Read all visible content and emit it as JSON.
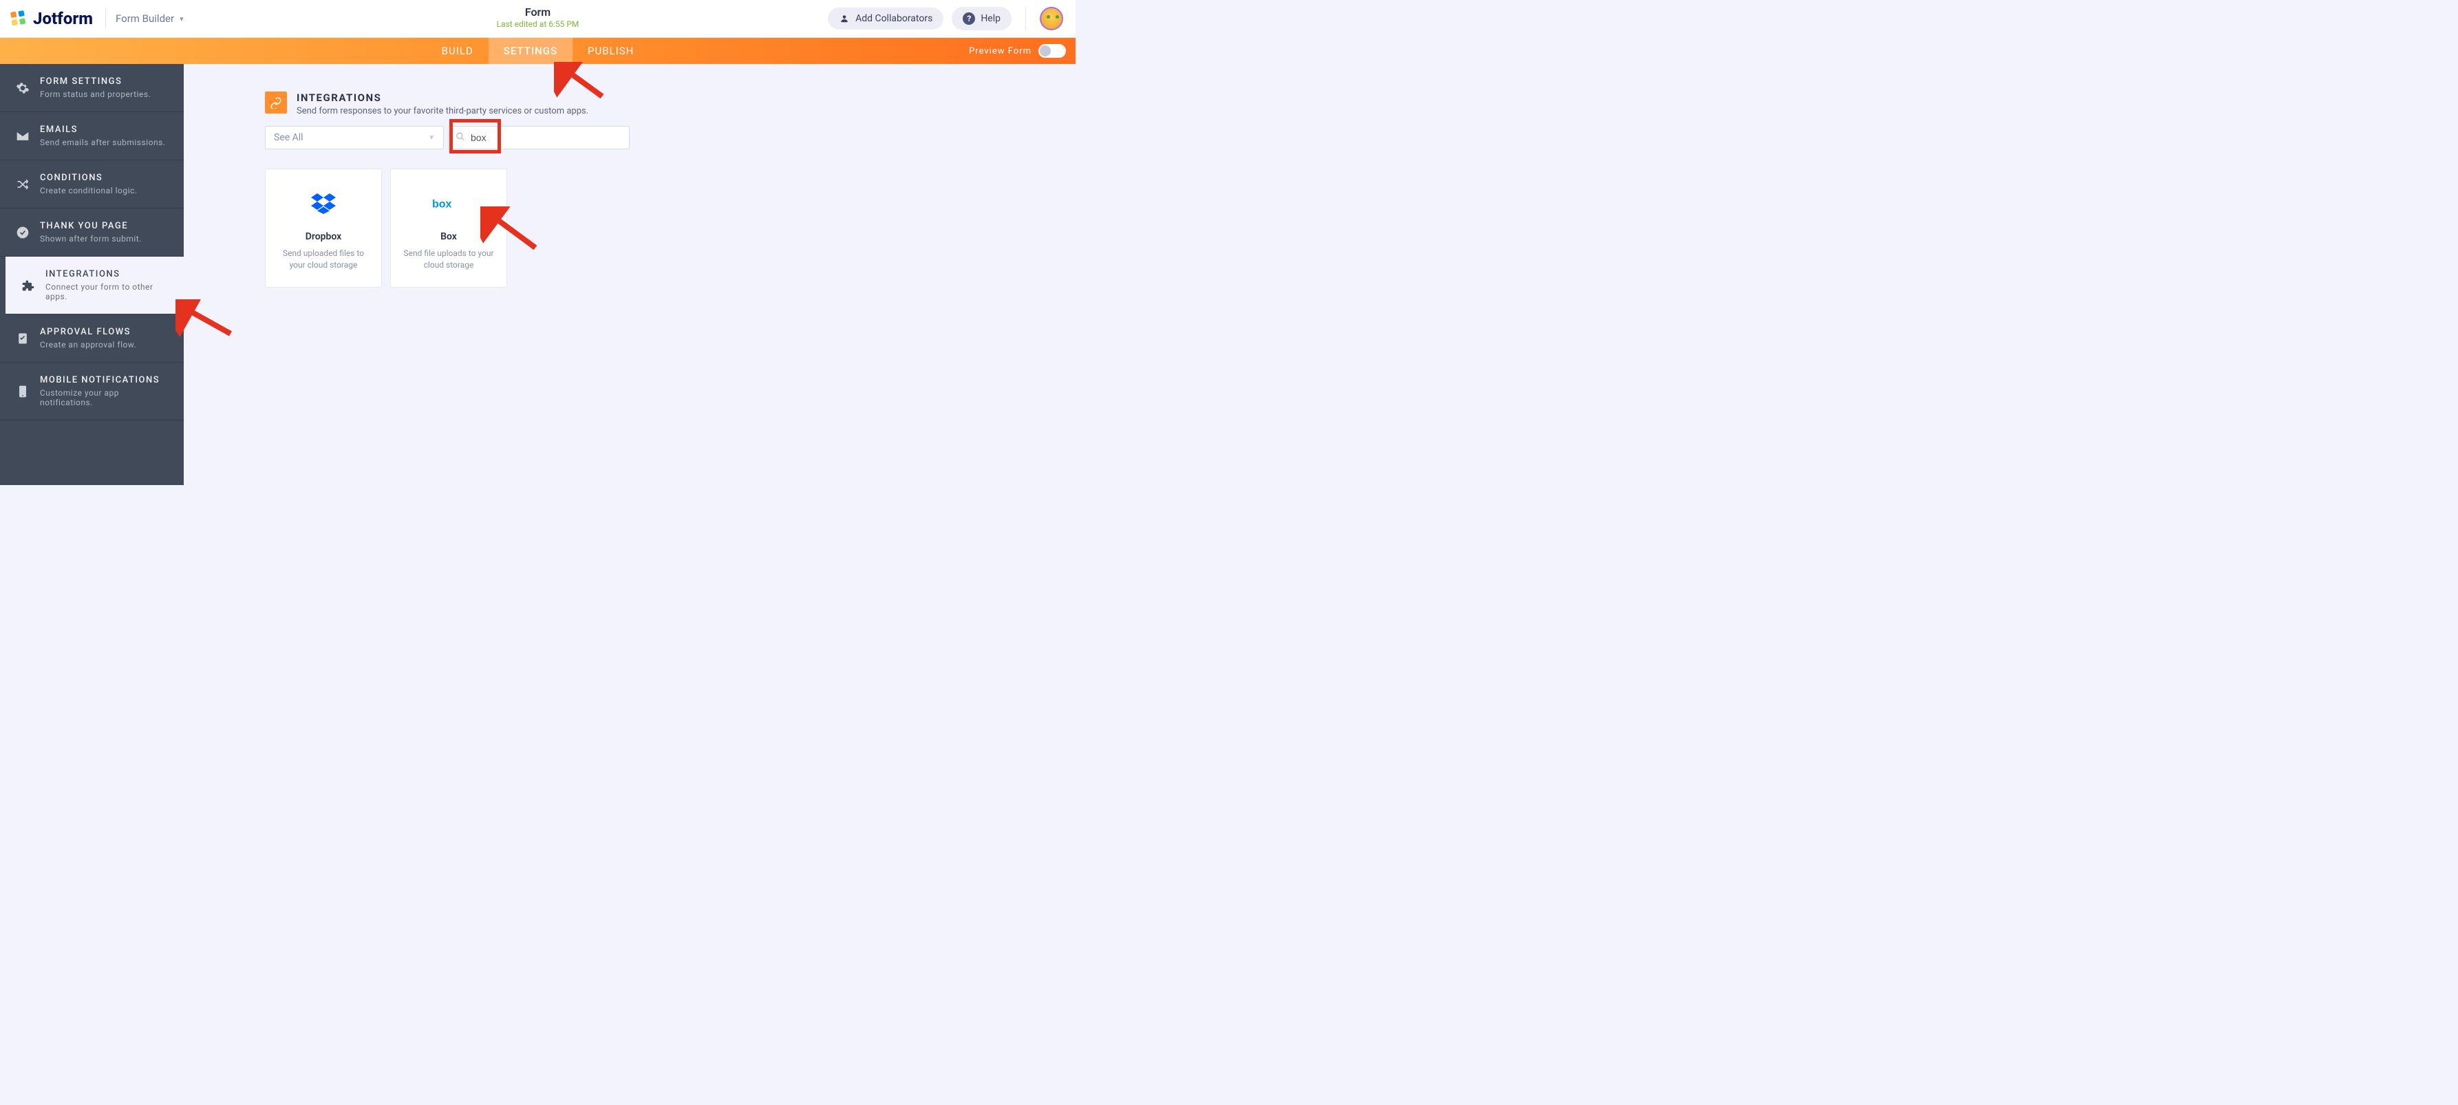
{
  "brand": "Jotform",
  "builder_label": "Form Builder",
  "form": {
    "title": "Form",
    "last_edited": "Last edited at 6:55 PM"
  },
  "header": {
    "collab": "Add Collaborators",
    "help": "Help"
  },
  "tabs": {
    "build": "BUILD",
    "settings": "SETTINGS",
    "publish": "PUBLISH"
  },
  "preview_label": "Preview Form",
  "sidebar": [
    {
      "title": "FORM SETTINGS",
      "sub": "Form status and properties."
    },
    {
      "title": "EMAILS",
      "sub": "Send emails after submissions."
    },
    {
      "title": "CONDITIONS",
      "sub": "Create conditional logic."
    },
    {
      "title": "THANK YOU PAGE",
      "sub": "Shown after form submit."
    },
    {
      "title": "INTEGRATIONS",
      "sub": "Connect your form to other apps."
    },
    {
      "title": "APPROVAL FLOWS",
      "sub": "Create an approval flow."
    },
    {
      "title": "MOBILE NOTIFICATIONS",
      "sub": "Customize your app notifications."
    }
  ],
  "page": {
    "title": "INTEGRATIONS",
    "subtitle": "Send form responses to your favorite third-party services or custom apps."
  },
  "filter": {
    "selected": "See All"
  },
  "search": {
    "value": "box"
  },
  "cards": [
    {
      "name": "Dropbox",
      "desc": "Send uploaded files to your cloud storage"
    },
    {
      "name": "Box",
      "desc": "Send file uploads to your cloud storage"
    }
  ]
}
